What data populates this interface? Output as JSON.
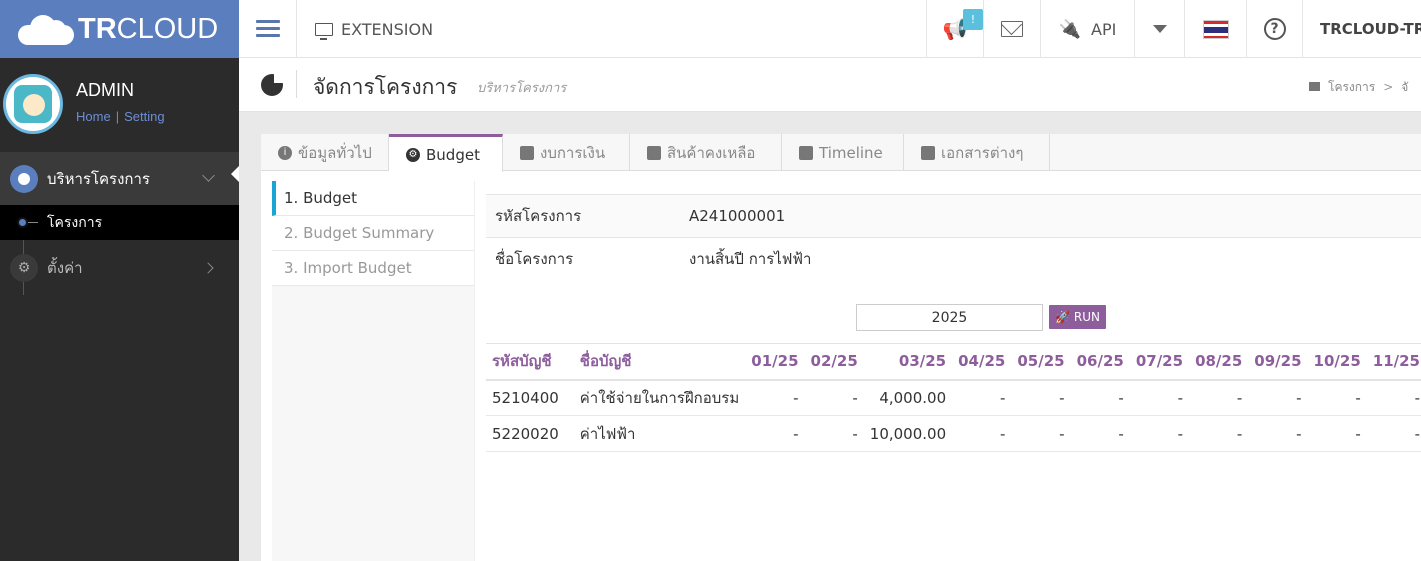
{
  "brand": {
    "bold": "TR",
    "light": "CLOUD"
  },
  "topbar": {
    "extension_label": "EXTENSION",
    "notification_count": "!",
    "api_label": "API",
    "user_label": "TRCLOUD-TRA"
  },
  "sidebar": {
    "user_name": "ADMIN",
    "home_link": "Home",
    "setting_link": "Setting",
    "main_item": "บริหารโครงการ",
    "sub_item": "โครงการ",
    "settings_item": "ตั้งค่า"
  },
  "page": {
    "title": "จัดการโครงการ",
    "subtitle": "บริหารโครงการ",
    "breadcrumb_1": "โครงการ",
    "breadcrumb_2": "จั"
  },
  "tabs": [
    {
      "label": "ข้อมูลทั่วไป",
      "icon": "info-icon"
    },
    {
      "label": "Budget",
      "icon": "gear-icon"
    },
    {
      "label": "งบการเงิน",
      "icon": "book-icon"
    },
    {
      "label": "สินค้าคงเหลือ",
      "icon": "cube-icon"
    },
    {
      "label": "Timeline",
      "icon": "calendar-icon"
    },
    {
      "label": "เอกสารต่างๆ",
      "icon": "folder-icon"
    }
  ],
  "steps": [
    "1. Budget",
    "2. Budget Summary",
    "3. Import Budget"
  ],
  "project": {
    "code_label": "รหัสโครงการ",
    "code_value": "A241000001",
    "name_label": "ชื่อโครงการ",
    "name_value": "งานสิ้นปี การไฟฟ้า"
  },
  "filter": {
    "year": "2025",
    "run_label": "RUN"
  },
  "table": {
    "headers": [
      "รหัสบัญชี",
      "ชื่อบัญชี",
      "01/25",
      "02/25",
      "03/25",
      "04/25",
      "05/25",
      "06/25",
      "07/25",
      "08/25",
      "09/25",
      "10/25",
      "11/25"
    ],
    "rows": [
      [
        "5210400",
        "ค่าใช้จ่ายในการฝึกอบรม",
        "-",
        "-",
        "4,000.00",
        "-",
        "-",
        "-",
        "-",
        "-",
        "-",
        "-",
        "-"
      ],
      [
        "5220020",
        "ค่าไฟฟ้า",
        "-",
        "-",
        "10,000.00",
        "-",
        "-",
        "-",
        "-",
        "-",
        "-",
        "-",
        "-"
      ]
    ]
  },
  "colors": {
    "brand": "#5b7fbe",
    "accent": "#8e5e9c",
    "active_step": "#1aa5d4"
  }
}
